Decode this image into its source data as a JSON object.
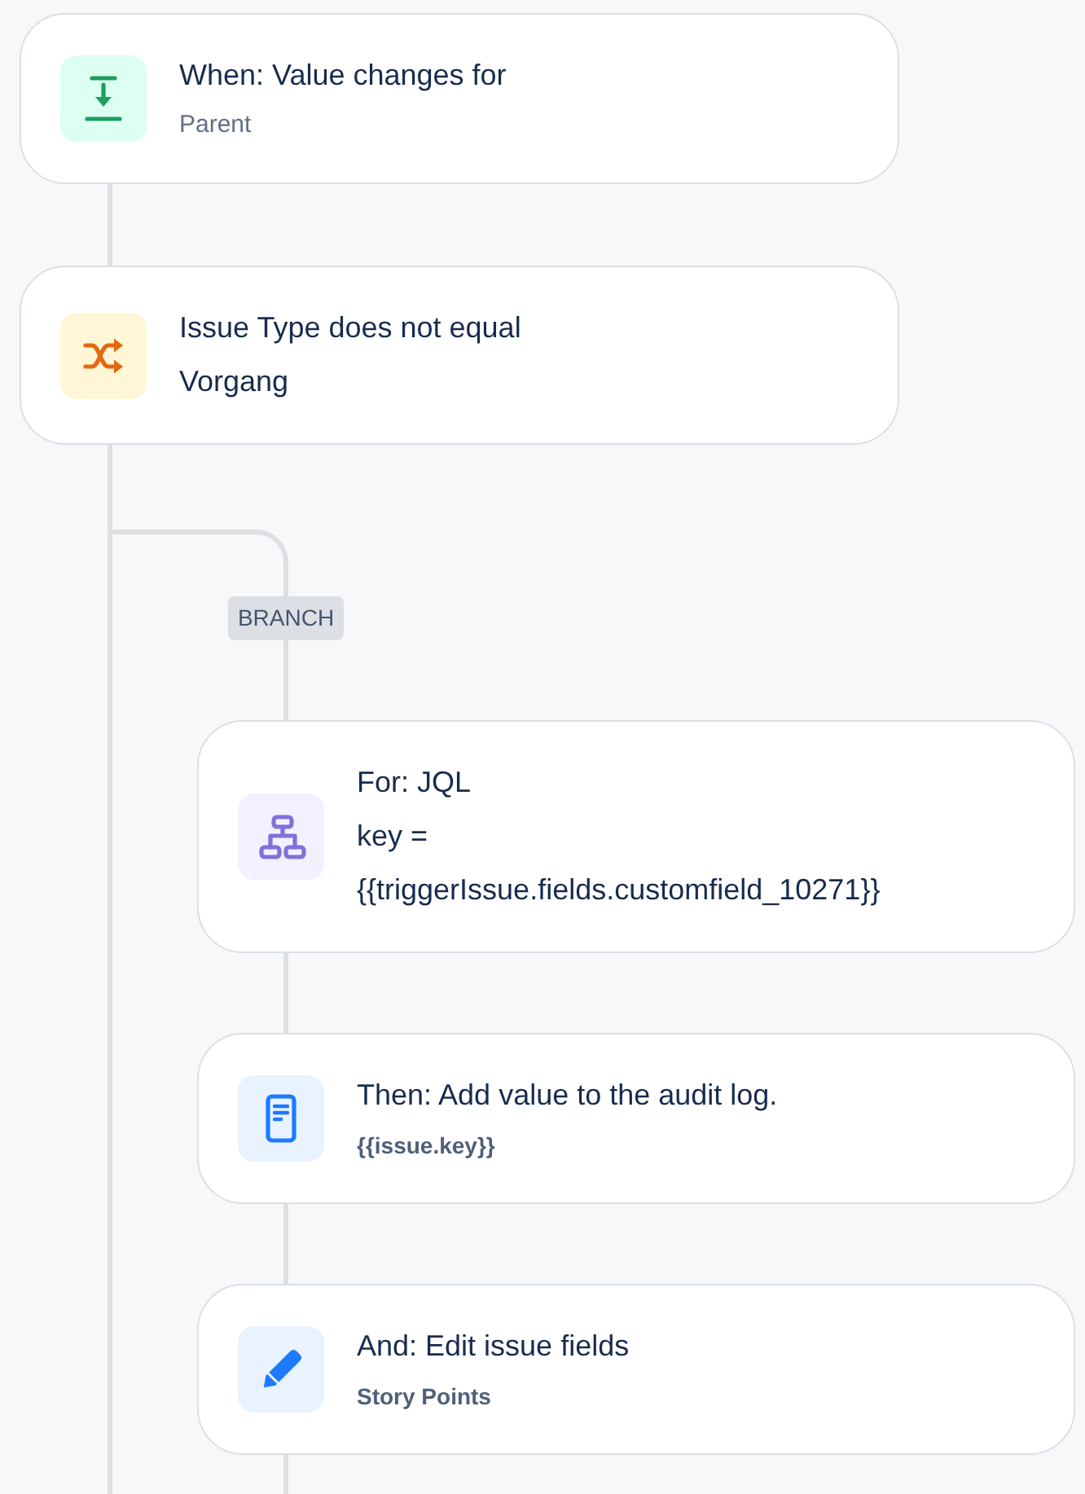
{
  "flow": {
    "steps": [
      {
        "kind": "trigger",
        "title": "When: Value changes for",
        "details": [
          {
            "kind": "note",
            "text": "Parent"
          }
        ]
      },
      {
        "kind": "condition",
        "title": "Issue Type does not equal",
        "details": [
          {
            "kind": "value",
            "text": "Vorgang"
          }
        ]
      }
    ],
    "branch": {
      "label": "BRANCH",
      "steps": [
        {
          "kind": "loop",
          "title": "For: JQL",
          "details": [
            {
              "kind": "value",
              "text": "key = {{triggerIssue.fields.customfield_10271}}"
            }
          ]
        },
        {
          "kind": "audit",
          "title": "Then: Add value to the audit log.",
          "details": [
            {
              "kind": "field",
              "text": "{{issue.key}}"
            }
          ]
        },
        {
          "kind": "edit",
          "title": "And: Edit issue fields",
          "details": [
            {
              "kind": "field",
              "text": "Story Points"
            }
          ]
        }
      ]
    }
  }
}
